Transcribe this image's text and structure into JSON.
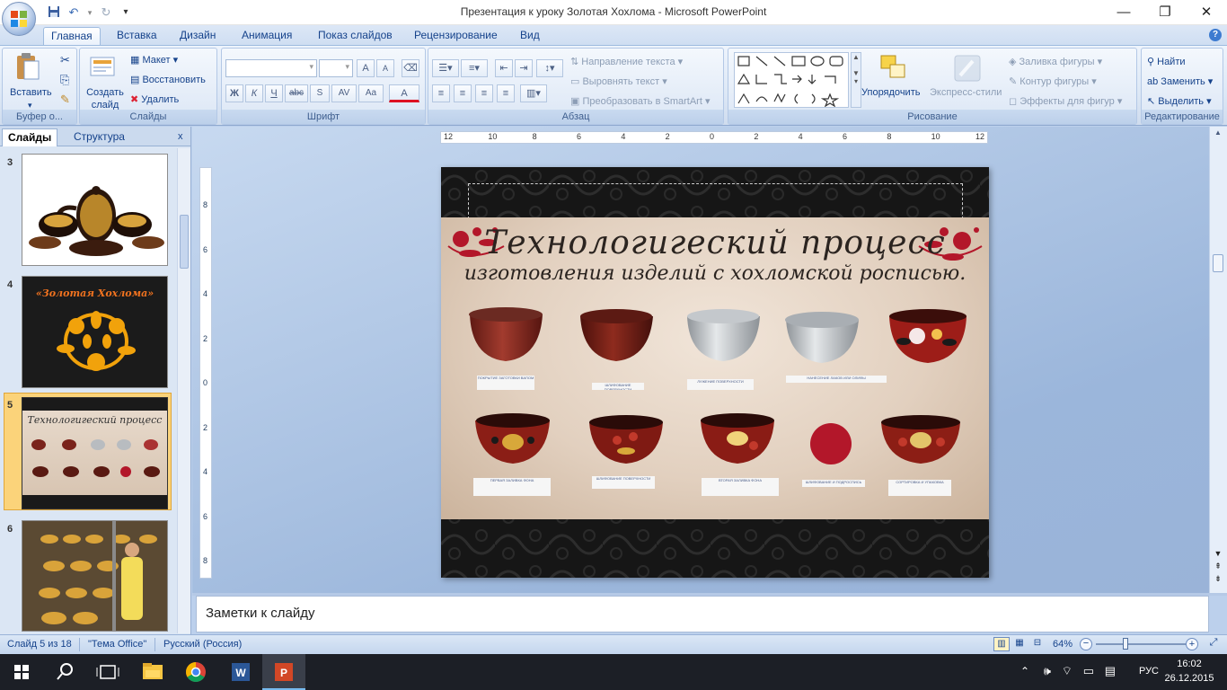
{
  "window": {
    "title": "Презентация к уроку Золотая Хохлома - Microsoft PowerPoint",
    "controls": [
      "—",
      "❐",
      "✕"
    ]
  },
  "qat": {
    "save": "save-icon",
    "undo": "undo-icon",
    "redo": "redo-icon",
    "more": "▾"
  },
  "tabs": [
    {
      "label": "Главная",
      "active": true
    },
    {
      "label": "Вставка"
    },
    {
      "label": "Дизайн"
    },
    {
      "label": "Анимация"
    },
    {
      "label": "Показ слайдов"
    },
    {
      "label": "Рецензирование"
    },
    {
      "label": "Вид"
    }
  ],
  "ribbon": {
    "clipboard": {
      "paste": "Вставить",
      "label": "Буфер о..."
    },
    "slides": {
      "new_slide": "Создать слайд",
      "layout": "Макет",
      "reset": "Восстановить",
      "delete": "Удалить",
      "label": "Слайды"
    },
    "font": {
      "label": "Шрифт",
      "grow": "A",
      "shrink": "A",
      "bold": "Ж",
      "italic": "К",
      "underline": "Ч",
      "strike": "abc",
      "spacing": "AV",
      "case": "Aa",
      "color": "A"
    },
    "paragraph": {
      "direction": "Направление текста",
      "align": "Выровнять текст",
      "smartart": "Преобразовать в SmartArt",
      "label": "Абзац"
    },
    "drawing": {
      "arrange": "Упорядочить",
      "quick_styles": "Экспресс-стили",
      "fill": "Заливка фигуры",
      "outline": "Контур фигуры",
      "effects": "Эффекты для фигур",
      "label": "Рисование"
    },
    "editing": {
      "find": "Найти",
      "replace": "Заменить",
      "select": "Выделить",
      "label": "Редактирование"
    }
  },
  "left_panel": {
    "tab_slides": "Слайды",
    "tab_outline": "Структура",
    "close": "x",
    "thumbs": [
      {
        "num": "3"
      },
      {
        "num": "4",
        "title": "«Золотая Хохлома»"
      },
      {
        "num": "5",
        "selected": true
      },
      {
        "num": "6"
      }
    ]
  },
  "ruler": {
    "h_ticks": [
      "12",
      "10",
      "8",
      "6",
      "4",
      "2",
      "0",
      "2",
      "4",
      "6",
      "8",
      "10",
      "12"
    ],
    "v_ticks": [
      "8",
      "6",
      "4",
      "2",
      "0",
      "2",
      "4",
      "6",
      "8"
    ]
  },
  "slide": {
    "title_line1": "Технологигеский процесс",
    "title_line2": "изготовления изделий с хохломской росписью.",
    "captions_row1": [
      "ПОКРЫТИЕ ЗАГОТОВКИ ВАПОМ",
      "ШЛИФОВАНИЕ ПОВЕРХНОСТИ",
      "ЛУЖЕНИЕ ПОВЕРХНОСТИ",
      "НАНЕСЕНИЕ ЛАКОВ ИЛИ ОЛИФЫ",
      ""
    ],
    "captions_row2": [
      "ПЕРВАЯ ЗАЛИВКА ФОНА",
      "ШЛИФОВАНИЕ ПОВЕРХНОСТИ",
      "ВТОРАЯ ЗАЛИВКА ФОНА",
      "ШЛИФОВАНИЕ И ПОДРОСПИСЬ",
      "СОРТИРОВКА И УПАКОВКА"
    ],
    "colors": {
      "bowl_red": "#7a231b",
      "bowl_silver": "#b8bcc0",
      "bowl_gold": "#c99a2a",
      "board": "#e3d2c2",
      "accent_red": "#b3172a"
    }
  },
  "notes": {
    "placeholder": "Заметки к слайду"
  },
  "status": {
    "slide_info": "Слайд 5 из 18",
    "theme": "\"Тема Office\"",
    "language": "Русский (Россия)",
    "zoom": "64%",
    "zoom_level": 0.64
  },
  "taskbar": {
    "apps": [
      "start-icon",
      "search-icon",
      "task-view-icon",
      "file-explorer-icon",
      "chrome-icon",
      "word-icon",
      "powerpoint-icon"
    ],
    "lang": "РУС",
    "time": "16:02",
    "date": "26.12.2015"
  }
}
